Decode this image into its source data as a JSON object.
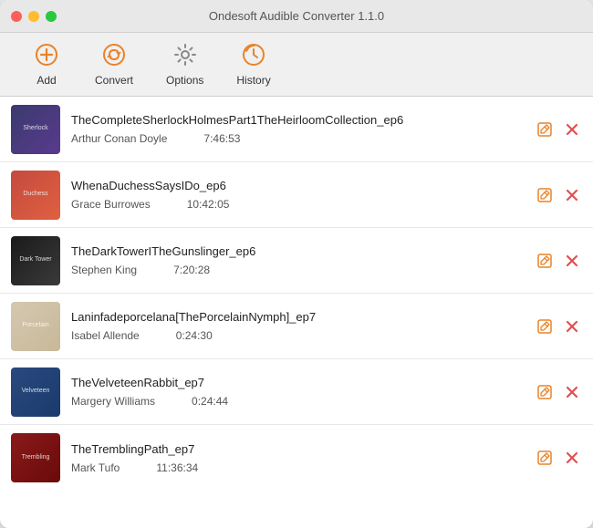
{
  "window": {
    "title": "Ondesoft Audible Converter 1.1.0"
  },
  "toolbar": {
    "add_label": "Add",
    "convert_label": "Convert",
    "options_label": "Options",
    "history_label": "History"
  },
  "books": [
    {
      "id": 1,
      "title": "TheCompleteSherlockHolmesPart1TheHeirloomCollection_ep6",
      "author": "Arthur Conan Doyle",
      "duration": "7:46:53",
      "cover_class": "cover-1",
      "cover_hint": "Sherlock"
    },
    {
      "id": 2,
      "title": "WhenaDuchessSaysIDo_ep6",
      "author": "Grace Burrowes",
      "duration": "10:42:05",
      "cover_class": "cover-2",
      "cover_hint": "Duchess"
    },
    {
      "id": 3,
      "title": "TheDarkTowerITheGunslinger_ep6",
      "author": "Stephen King",
      "duration": "7:20:28",
      "cover_class": "cover-3",
      "cover_hint": "Dark Tower"
    },
    {
      "id": 4,
      "title": "Laninfadeporcelana[ThePorcelainNymph]_ep7",
      "author": "Isabel Allende",
      "duration": "0:24:30",
      "cover_class": "cover-4",
      "cover_hint": "Porcelain"
    },
    {
      "id": 5,
      "title": "TheVelveteenRabbit_ep7",
      "author": "Margery Williams",
      "duration": "0:24:44",
      "cover_class": "cover-5",
      "cover_hint": "Velveteen"
    },
    {
      "id": 6,
      "title": "TheTremblingPath_ep7",
      "author": "Mark Tufo",
      "duration": "11:36:34",
      "cover_class": "cover-6",
      "cover_hint": "Trembling"
    }
  ]
}
